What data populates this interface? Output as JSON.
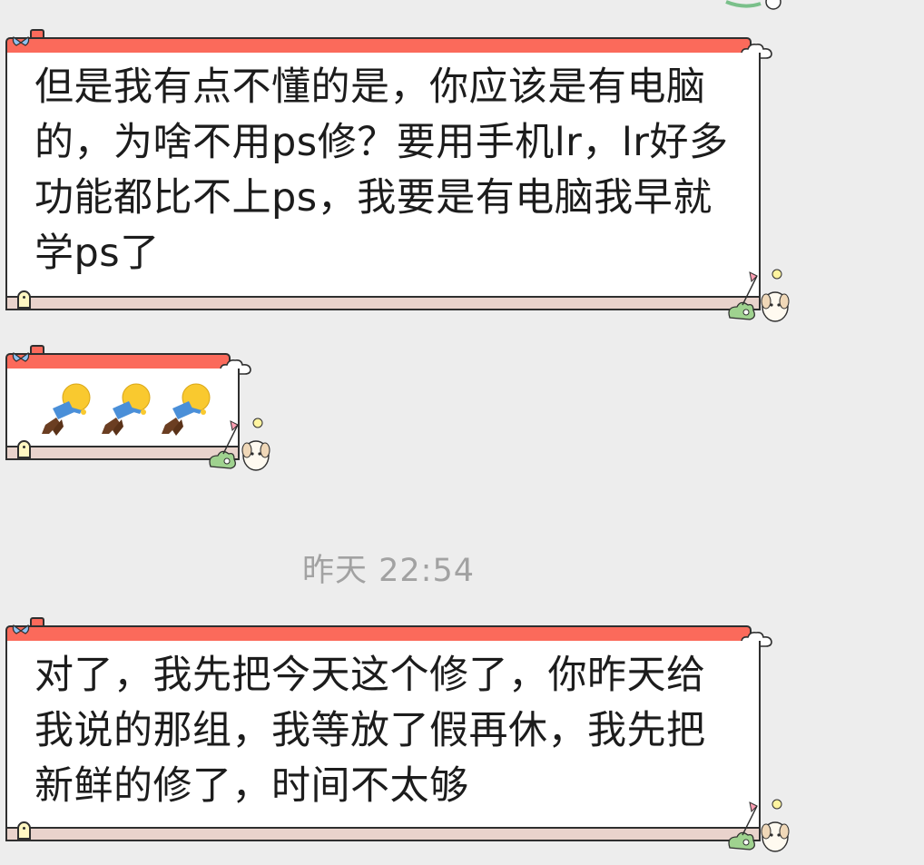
{
  "messages": [
    {
      "text": "但是我有点不懂的是，你应该是有电脑的，为啥不用ps修？要用手机lr，lr好多功能都比不上ps，我要是有电脑我早就学ps了"
    },
    {
      "emoji_count": 3,
      "emoji_icon": "lying-person-emoji"
    },
    {
      "text": "对了，我先把今天这个修了，你昨天给我说的那组，我等放了假再休，我先把新鲜的修了，时间不太够"
    }
  ],
  "timestamp": "昨天 22:54",
  "colors": {
    "roof": "#fb6a5b",
    "floor": "#e9d3cc",
    "background": "#ededed",
    "text": "#1c1c1c",
    "timestamp": "#a2a2a2"
  }
}
